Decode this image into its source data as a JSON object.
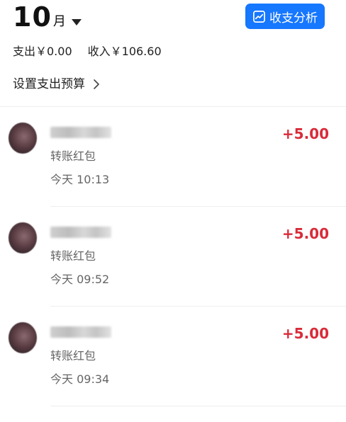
{
  "header": {
    "month": "10",
    "month_unit": "月",
    "analysis_button": "收支分析",
    "expense": "支出￥0.00",
    "income": "收入￥106.60",
    "budget_link": "设置支出预算"
  },
  "transactions": [
    {
      "description": "转账红包",
      "time": "今天 10:13",
      "amount": "+5.00"
    },
    {
      "description": "转账红包",
      "time": "今天 09:52",
      "amount": "+5.00"
    },
    {
      "description": "转账红包",
      "time": "今天 09:34",
      "amount": "+5.00"
    }
  ],
  "colors": {
    "accent": "#1677ff",
    "income_amount": "#d92b39",
    "secondary_text": "#666666"
  }
}
